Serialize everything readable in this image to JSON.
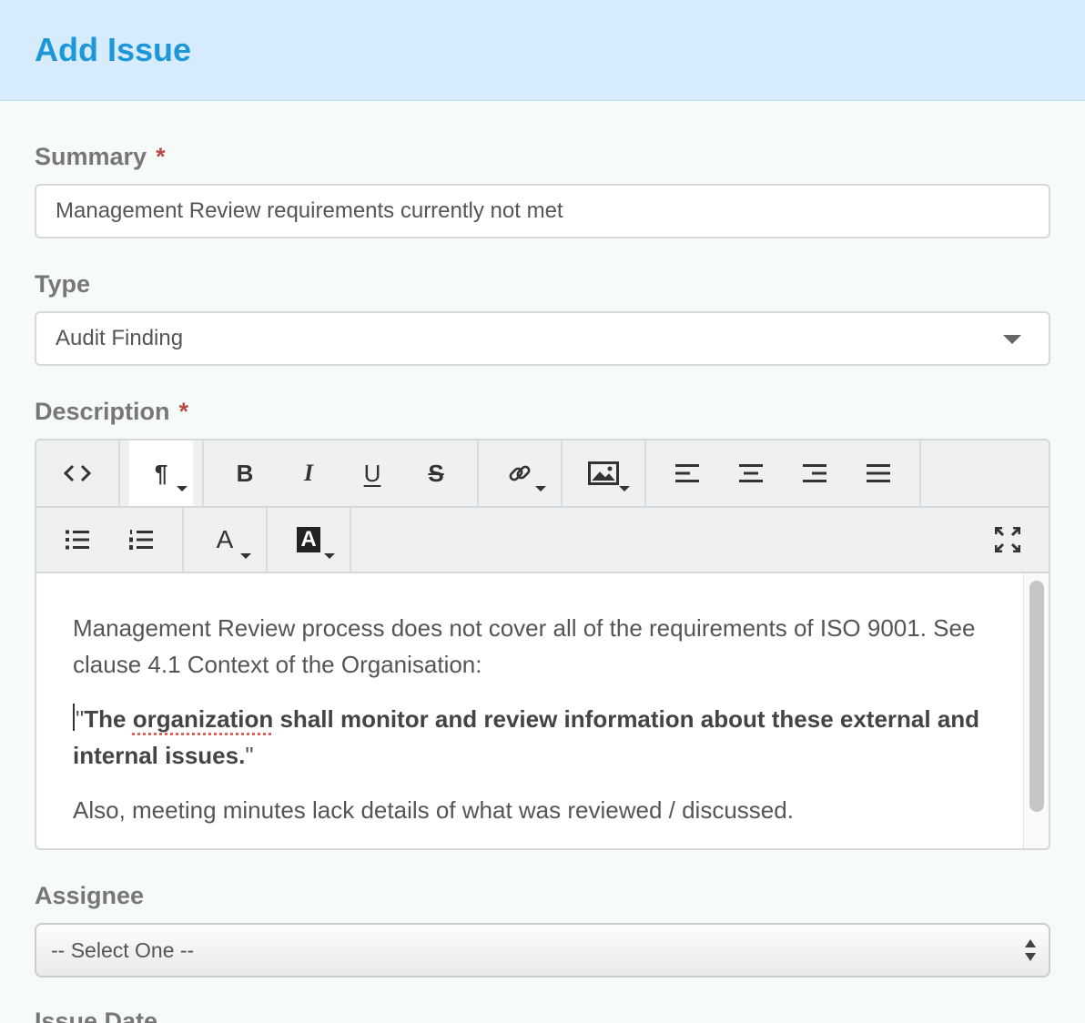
{
  "header": {
    "title": "Add Issue"
  },
  "summary": {
    "label": "Summary",
    "required_mark": "*",
    "value": "Management Review requirements currently not met"
  },
  "type": {
    "label": "Type",
    "value": "Audit Finding"
  },
  "description": {
    "label": "Description",
    "required_mark": "*",
    "toolbar": {
      "paragraph_glyph": "¶",
      "bold_glyph": "B",
      "italic_glyph": "I",
      "underline_glyph": "U",
      "strike_glyph": "S",
      "font_color_glyph": "A",
      "bg_color_glyph": "A"
    },
    "content": {
      "p1": "Management Review process does not cover all of the requirements of ISO 9001. See clause 4.1 Context of the Organisation:",
      "p2_open_quote": "\"",
      "p2_bold_before": "The ",
      "p2_spell": "organization",
      "p2_bold_after": " shall monitor and review information about these external and internal issues.",
      "p2_close_quote": "\"",
      "p3": "Also, meeting minutes lack details of what was reviewed / discussed."
    }
  },
  "assignee": {
    "label": "Assignee",
    "value": "-- Select One --"
  },
  "issue_date": {
    "label": "Issue Date"
  }
}
